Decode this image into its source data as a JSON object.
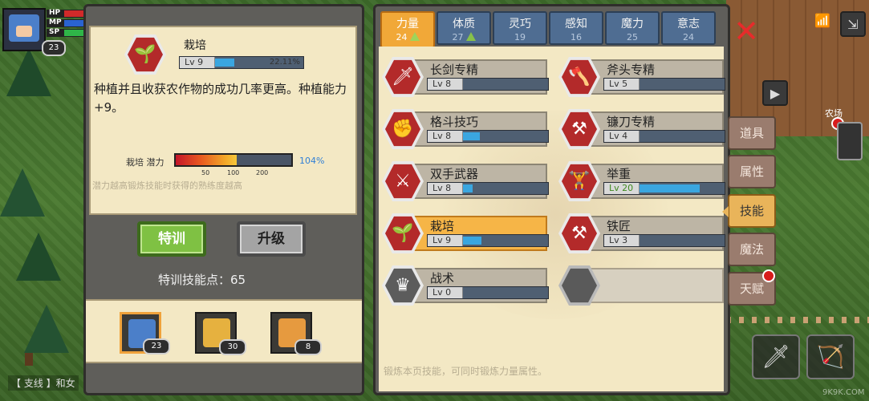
{
  "hud": {
    "level": "23",
    "bars": [
      {
        "label": "HP",
        "color": "#d12a2a",
        "fill": 1.0
      },
      {
        "label": "MP",
        "color": "#2a63d1",
        "fill": 1.0
      },
      {
        "label": "SP",
        "color": "#2fb548",
        "fill": 1.0
      }
    ]
  },
  "detail": {
    "icon": "sprout-icon",
    "name": "栽培",
    "level": "Lv 9",
    "progress": 0.2211,
    "progress_text": "22.11%",
    "description": "种植并且收获农作物的成功几率更高。种植能力+9。",
    "potential_label": "栽培 潜力",
    "potential": 1.04,
    "potential_text": "104%",
    "ticks": [
      "50",
      "100",
      "200"
    ],
    "hint": "潜力越高锻炼技能时获得的熟练度越高"
  },
  "buttons": {
    "train": "特训",
    "upgrade": "升级"
  },
  "points": {
    "label": "特训技能点：",
    "value": "65"
  },
  "party": [
    {
      "level": "23",
      "selected": true,
      "color": "#4b7fc9"
    },
    {
      "level": "30",
      "selected": false,
      "color": "#e6b13f"
    },
    {
      "level": "8",
      "selected": false,
      "color": "#e69a3f"
    }
  ],
  "quest_text": "【 支线 】和女",
  "tabs": [
    {
      "name": "力量",
      "value": "24",
      "up": true,
      "active": true
    },
    {
      "name": "体质",
      "value": "27",
      "up": true,
      "active": false
    },
    {
      "name": "灵巧",
      "value": "19",
      "up": false,
      "active": false
    },
    {
      "name": "感知",
      "value": "16",
      "up": false,
      "active": false
    },
    {
      "name": "魔力",
      "value": "25",
      "up": false,
      "active": false
    },
    {
      "name": "意志",
      "value": "24",
      "up": false,
      "active": false
    }
  ],
  "skills": [
    {
      "name": "长剑专精",
      "level": "Lv 8",
      "progress": 0.0,
      "icon": "sword-icon",
      "glyph": "🗡"
    },
    {
      "name": "斧头专精",
      "level": "Lv 5",
      "progress": 0.0,
      "icon": "axe-icon",
      "glyph": "🪓"
    },
    {
      "name": "格斗技巧",
      "level": "Lv 8",
      "progress": 0.2,
      "icon": "fist-icon",
      "glyph": "✊"
    },
    {
      "name": "镰刀专精",
      "level": "Lv 4",
      "progress": 0.0,
      "icon": "scythe-icon",
      "glyph": "⚒"
    },
    {
      "name": "双手武器",
      "level": "Lv 8",
      "progress": 0.12,
      "icon": "crossed-swords-icon",
      "glyph": "⚔"
    },
    {
      "name": "举重",
      "level": "Lv 20",
      "progress": 0.72,
      "icon": "dumbbell-icon",
      "glyph": "🏋"
    },
    {
      "name": "栽培",
      "level": "Lv 9",
      "progress": 0.22,
      "icon": "sprout-icon",
      "glyph": "🌱",
      "highlight": true
    },
    {
      "name": "铁匠",
      "level": "Lv 3",
      "progress": 0.0,
      "icon": "anvil-icon",
      "glyph": "⚒"
    },
    {
      "name": "战术",
      "level": "Lv 0",
      "progress": 0.0,
      "icon": "tactics-icon",
      "glyph": "♛",
      "gray": true
    }
  ],
  "skills_hint": "锻炼本页技能，可同时锻炼力量属性。",
  "side_tabs": [
    "道具",
    "属性",
    "技能",
    "魔法",
    "天赋"
  ],
  "farm_label": "农场",
  "site_mark": "9K9K.COM",
  "colors": {
    "accent": "#f1a838",
    "skill_red": "#b32a2a",
    "bar_blue": "#3aa6e0",
    "parchment": "#f3e8c4"
  }
}
